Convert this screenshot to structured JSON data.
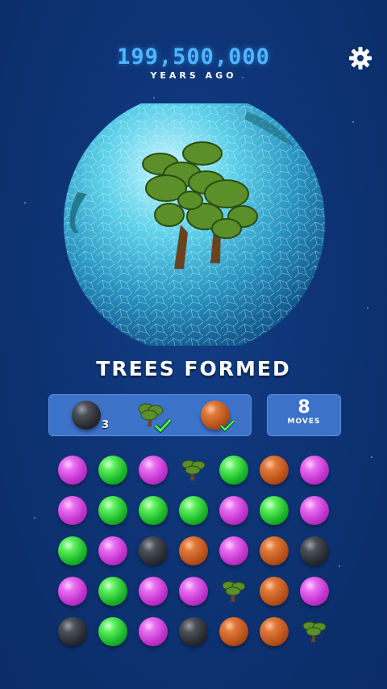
{
  "header": {
    "year": "199,500,000",
    "ago_label": "YEARS AGO"
  },
  "icons": {
    "settings": "gear-icon"
  },
  "milestone": {
    "caption": "TREES FORMED"
  },
  "goals": [
    {
      "type": "black",
      "count": "3",
      "done": false
    },
    {
      "type": "tree",
      "count": "",
      "done": true
    },
    {
      "type": "brown",
      "count": "",
      "done": true
    }
  ],
  "moves": {
    "count": "8",
    "label": "MOVES"
  },
  "colors": {
    "background": "#0d3172",
    "panel": "#3d72c9",
    "year_text": "#4fb6ff",
    "magenta": "#c233cf",
    "green": "#1cb82a",
    "black": "#26292e",
    "brown": "#b8501a"
  },
  "board": {
    "rows": [
      [
        "magenta",
        "green",
        "magenta",
        "tree",
        "green",
        "brown",
        "magenta"
      ],
      [
        "magenta",
        "green",
        "green",
        "green",
        "magenta",
        "green",
        "magenta"
      ],
      [
        "green",
        "magenta",
        "black",
        "brown",
        "magenta",
        "brown",
        "black"
      ],
      [
        "magenta",
        "green",
        "magenta",
        "magenta",
        "tree",
        "brown",
        "magenta"
      ],
      [
        "black",
        "green",
        "magenta",
        "black",
        "brown",
        "brown",
        "tree"
      ]
    ]
  }
}
